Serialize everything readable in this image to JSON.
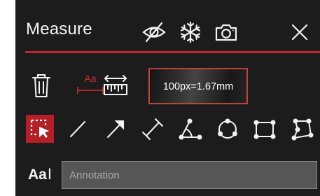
{
  "panel": {
    "title": "Measure",
    "accent_color": "#c0272d",
    "background_color": "#1c1c1c"
  },
  "header_icons": [
    "hide-eye-icon",
    "freeze-snowflake-icon",
    "camera-icon",
    "close-icon"
  ],
  "toolbar_row1": {
    "icons": [
      "trash-icon",
      "label-aa-icon",
      "calibrate-ruler-icon"
    ],
    "label_icon_text": "Aa",
    "calibration": "100px=1.67mm"
  },
  "toolbar_row2": {
    "tools": [
      "select-tool-icon",
      "line-tool-icon",
      "arrow-tool-icon",
      "dimension-tool-icon",
      "angle-tool-icon",
      "circle-tool-icon",
      "rectangle-tool-icon",
      "polygon-tool-icon"
    ],
    "active_tool": "select-tool-icon"
  },
  "annotation": {
    "icon_text": "Aa",
    "placeholder": "Annotation",
    "value": ""
  }
}
